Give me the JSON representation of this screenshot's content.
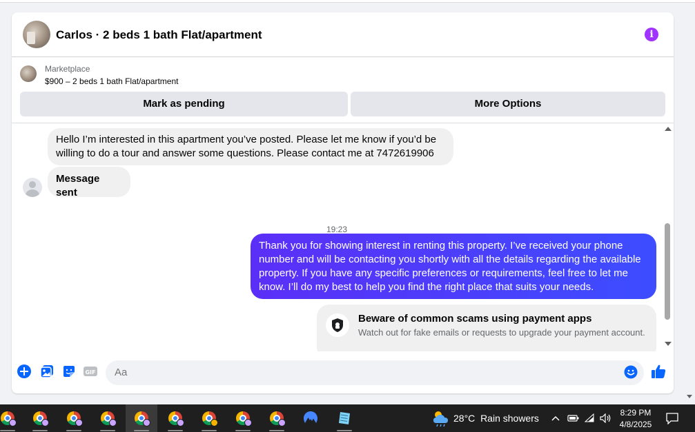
{
  "header": {
    "title": "Carlos · 2 beds 1 bath Flat/apartment"
  },
  "marketplace": {
    "label": "Marketplace",
    "listing": "$900 – 2 beds 1 bath Flat/apartment",
    "mark_pending_label": "Mark as pending",
    "more_options_label": "More Options"
  },
  "thread": {
    "messages": [
      {
        "direction": "incoming",
        "text": "Hello I’m interested in this apartment you’ve posted. Please let me know if you’d be willing to do a tour and answer some questions. Please contact me at 7472619906"
      },
      {
        "direction": "incoming",
        "text": "Message sent"
      },
      {
        "direction": "outgoing",
        "text": "Thank you for showing interest in renting this property. I’ve received your phone number and will be contacting you shortly with all the details regarding the available property. If you have any specific preferences or requirements, feel free to let me know. I’ll do my best to help you find the right place that suits your needs."
      }
    ],
    "timestamp": "19:23",
    "scam_notice": {
      "title": "Beware of common scams using payment apps",
      "subtitle": "Watch out for fake emails or requests to upgrade your payment account."
    }
  },
  "composer": {
    "placeholder": "Aa",
    "icons": [
      "plus-icon",
      "photo-icon",
      "sticker-icon",
      "gif-icon",
      "emoji-icon",
      "like-icon"
    ]
  },
  "taskbar": {
    "apps": [
      "chrome",
      "chrome",
      "chrome",
      "chrome",
      "chrome",
      "chrome",
      "chrome",
      "chrome",
      "chrome",
      "nordvpn",
      "notepad"
    ],
    "weather": {
      "temperature": "28°C",
      "condition": "Rain showers"
    },
    "time": "8:29 PM",
    "date": "4/8/2025"
  },
  "colors": {
    "accent": "#0866ff",
    "outgoing_bubble_start": "#5b2ff7",
    "outgoing_bubble_end": "#3d4dff",
    "info_icon": "#a033ff"
  }
}
